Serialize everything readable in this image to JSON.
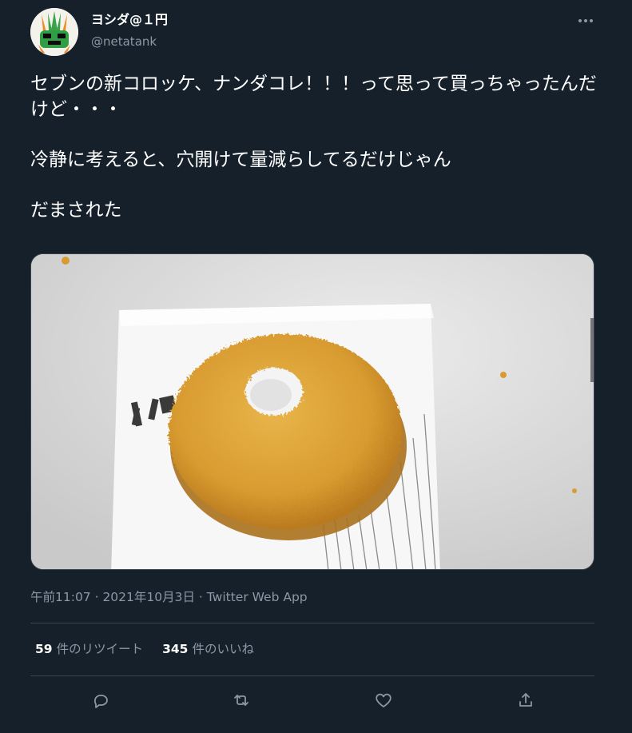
{
  "user": {
    "display_name": "ヨシダ@１円",
    "handle": "@netatank"
  },
  "tweet": {
    "text": "セブンの新コロッケ、ナンダコレ！！！って思って買っちゃったんだけど・・・\n\n冷静に考えると、穴開けて量減らしてるだけじゃん\n\nだまされた",
    "timestamp": "午前11:07 · 2021年10月3日 · Twitter Web App"
  },
  "stats": {
    "retweet_count": "59",
    "retweet_label": "件のリツイート",
    "like_count": "345",
    "like_label": "件のいいね"
  },
  "actions": {
    "icons": [
      "reply-icon",
      "retweet-icon",
      "like-icon",
      "share-icon"
    ]
  },
  "colors": {
    "background": "#15202b",
    "text": "#ffffff",
    "secondary": "#8b98a5",
    "divider": "#38444d"
  }
}
